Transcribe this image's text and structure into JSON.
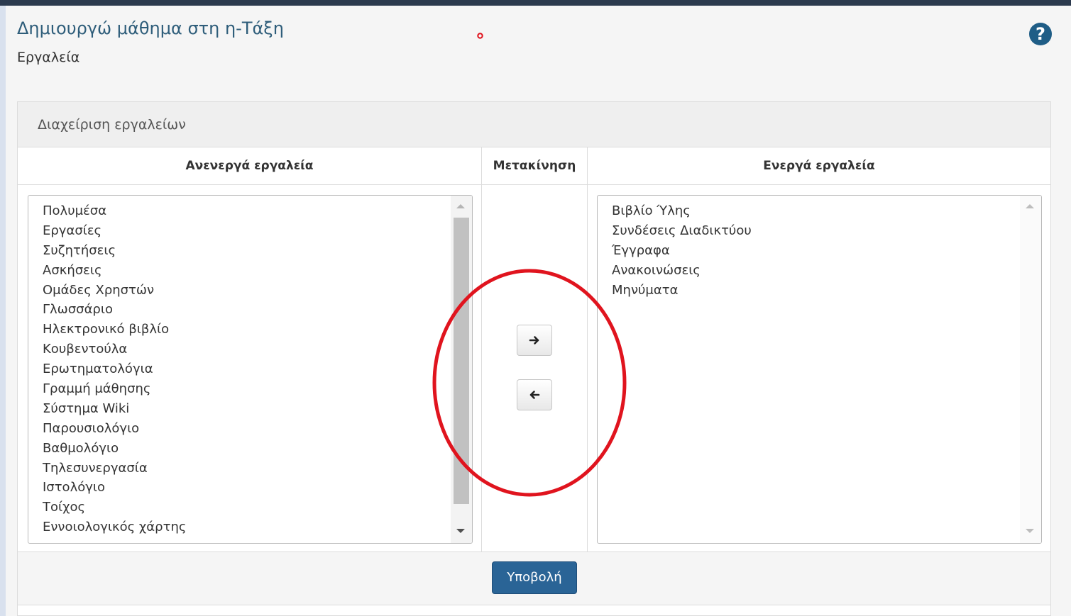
{
  "header": {
    "title": "Δημιουργώ μάθημα στη η-Τάξη",
    "subtitle": "Εργαλεία",
    "help_icon": "?"
  },
  "panel": {
    "heading": "Διαχείριση εργαλείων",
    "columns": {
      "inactive": "Ανενεργά εργαλεία",
      "move": "Μετακίνηση",
      "active": "Ενεργά εργαλεία"
    },
    "inactive_tools": [
      "Πολυμέσα",
      "Εργασίες",
      "Συζητήσεις",
      "Ασκήσεις",
      "Ομάδες Χρηστών",
      "Γλωσσάριο",
      "Ηλεκτρονικό βιβλίο",
      "Κουβεντούλα",
      "Ερωτηματολόγια",
      "Γραμμή μάθησης",
      "Σύστημα Wiki",
      "Παρουσιολόγιο",
      "Βαθμολόγιο",
      "Τηλεσυνεργασία",
      "Ιστολόγιο",
      "Τοίχος",
      "Εννοιολογικός χάρτης"
    ],
    "active_tools": [
      "Βιβλίο Ύλης",
      "Συνδέσεις Διαδικτύου",
      "Έγγραφα",
      "Ανακοινώσεις",
      "Μηνύματα"
    ],
    "move_right_icon": "arrow-right",
    "move_left_icon": "arrow-left",
    "submit_label": "Υποβολή"
  },
  "colors": {
    "title": "#2e5d7a",
    "help": "#1f5d86",
    "submit": "#2a6496",
    "annotation": "#e0141e"
  }
}
